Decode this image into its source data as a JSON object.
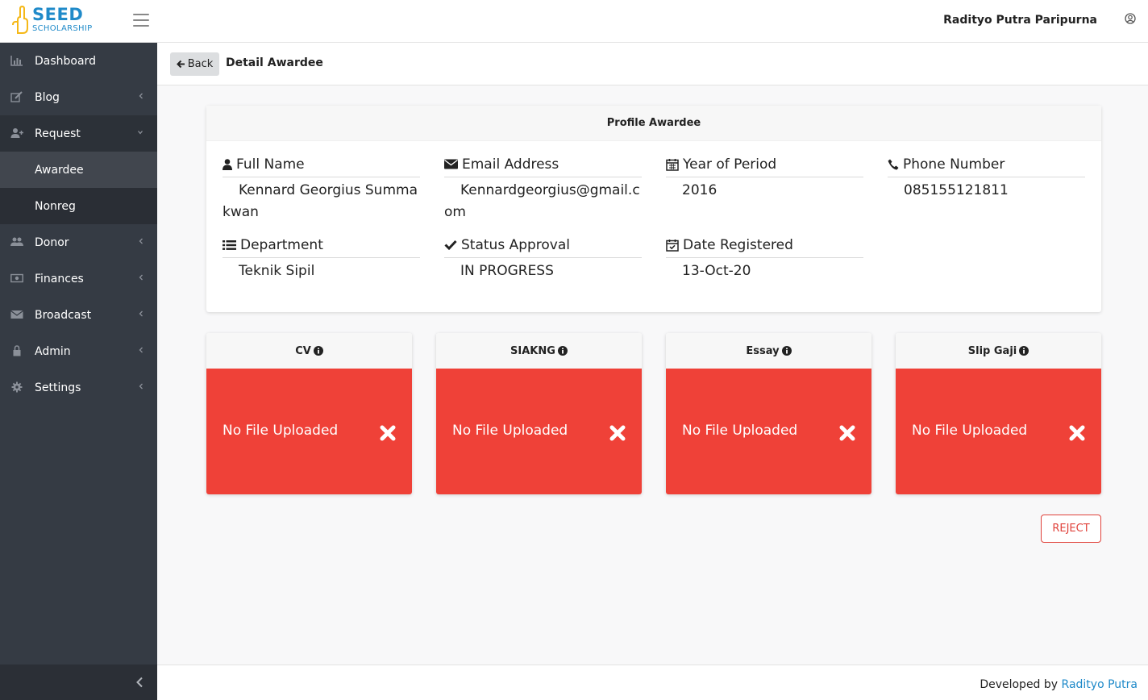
{
  "brand": {
    "name": "SEED",
    "sub": "SCHOLARSHIP",
    "icon": "hand-logo-icon",
    "color": "#1f8ac9"
  },
  "header": {
    "user_name": "Radityo Putra Paripurna",
    "user_icon": "user-circle-icon"
  },
  "sidebar": {
    "items": [
      {
        "label": "Dashboard",
        "icon": "bar-chart-icon"
      },
      {
        "label": "Blog",
        "icon": "edit-icon"
      },
      {
        "label": "Request",
        "icon": "user-plus-icon"
      },
      {
        "label": "Donor",
        "icon": "users-icon"
      },
      {
        "label": "Finances",
        "icon": "money-icon"
      },
      {
        "label": "Broadcast",
        "icon": "envelope-icon"
      },
      {
        "label": "Admin",
        "icon": "lock-icon"
      },
      {
        "label": "Settings",
        "icon": "gear-icon"
      }
    ],
    "request_sub": [
      {
        "label": "Awardee"
      },
      {
        "label": "Nonreg"
      }
    ]
  },
  "content": {
    "back_label": "Back",
    "page_title": "Detail Awardee"
  },
  "profile": {
    "title": "Profile Awardee",
    "fields": {
      "full_name": {
        "label": "Full Name",
        "value": "Kennard Georgius Summakwan"
      },
      "email": {
        "label": "Email Address",
        "value": "Kennardgeorgius@gmail.com"
      },
      "year": {
        "label": "Year of Period",
        "value": "2016"
      },
      "phone": {
        "label": "Phone Number",
        "value": "085155121811"
      },
      "department": {
        "label": "Department",
        "value": "Teknik Sipil"
      },
      "status": {
        "label": "Status Approval",
        "value": "IN PROGRESS"
      },
      "registered": {
        "label": "Date Registered",
        "value": "13-Oct-20"
      }
    }
  },
  "documents": [
    {
      "title": "CV",
      "status": "No File Uploaded"
    },
    {
      "title": "SIAKNG",
      "status": "No File Uploaded"
    },
    {
      "title": "Essay",
      "status": "No File Uploaded"
    },
    {
      "title": "Slip Gaji",
      "status": "No File Uploaded"
    }
  ],
  "colors": {
    "sidebar": "#353b44",
    "danger": "#ef4138",
    "link": "#1f8ac9"
  },
  "reject_label": "REJECT",
  "footer": {
    "prefix": "Developed by",
    "link": "Radityo Putra"
  }
}
